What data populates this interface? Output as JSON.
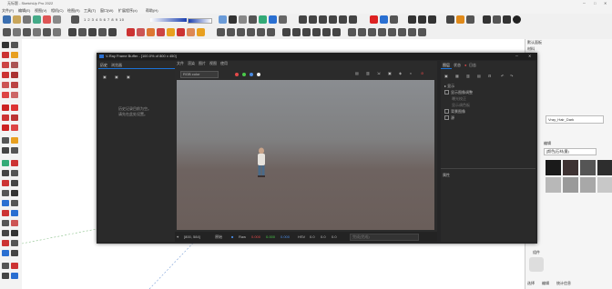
{
  "app": {
    "title": "无标题 - SketchUp Pro 2022"
  },
  "menu": [
    "文件(F)",
    "编辑(E)",
    "视图(V)",
    "相机(C)",
    "绘图(R)",
    "工具(T)",
    "窗口(W)",
    "扩展程序(x)",
    "帮助(H)"
  ],
  "toolbar": {
    "numbers": "1 2 3 4 5 6 7 8 9 10"
  },
  "tray": {
    "title": "默认面板",
    "section": "材料",
    "material_name": "Vray_Hair_Dark",
    "edit_tab": "编辑",
    "select_value": "[颜色]石材(墨)",
    "components_title": "组件",
    "bottom_tabs": [
      "选择",
      "编辑",
      "统计信息"
    ]
  },
  "vfb": {
    "title": "V-Ray Frame Buffer - [100.0% of 800 x 450]",
    "menu": [
      "文件",
      "渲染",
      "图片",
      "视图",
      "使用"
    ],
    "left_tabs": [
      "历史",
      "浏览器"
    ],
    "history_msg_1": "历史记录目前为空。",
    "history_msg_2": "请先在此处设置。",
    "channel": "RGB color",
    "right_tabs": [
      "图层",
      "状态",
      "日志"
    ],
    "layers": [
      "显示",
      "显示图像调整",
      "曝光校正",
      "显示调色板",
      "背景图像",
      "源"
    ],
    "attrs_label": "属性",
    "status": {
      "resolution": "[800, 584]",
      "label_original": "原始",
      "mode": "Raw",
      "r": "0.000",
      "g": "0.000",
      "b": "0.000",
      "hsv_label": "HSV",
      "hsv": "0.0",
      "extra": "0.0",
      "progress_label": "完成(完成)"
    }
  },
  "colors": {
    "accent_blue": "#1a73d9",
    "vfb_bg": "#252526",
    "render_top": "#8a8d91",
    "render_floor": "#6a5e5a"
  }
}
